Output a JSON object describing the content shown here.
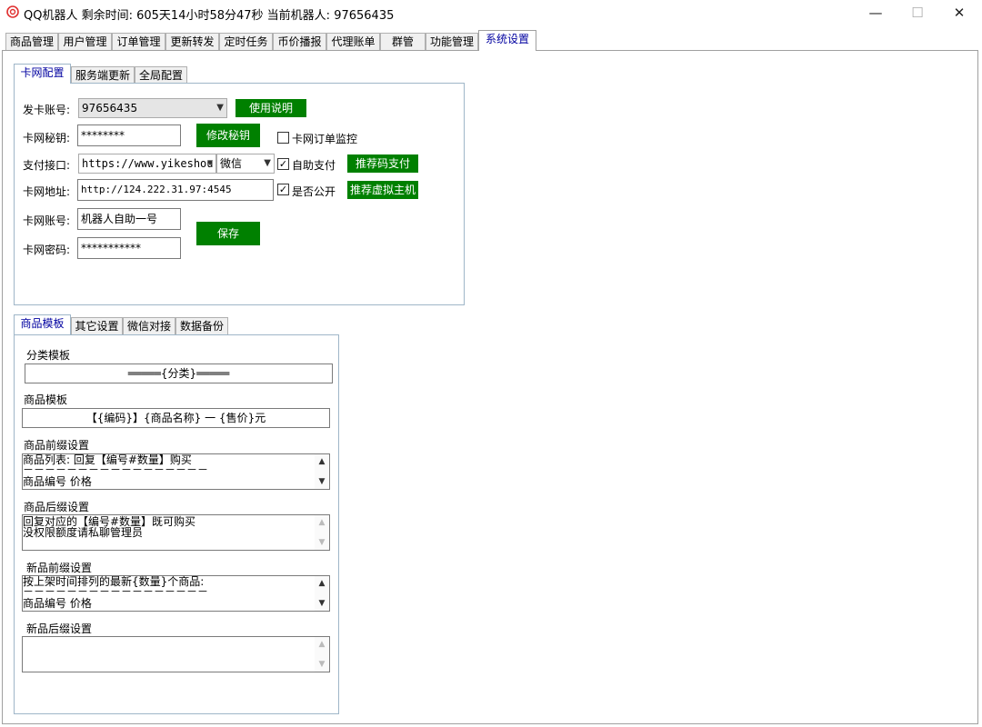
{
  "window": {
    "title": "QQ机器人 剩余时间: 605天14小时58分47秒 当前机器人: 97656435",
    "minimize": "—",
    "maximize": "☐",
    "close": "✕"
  },
  "main_tabs": [
    "商品管理",
    "用户管理",
    "订单管理",
    "更新转发",
    "定时任务",
    "币价播报",
    "代理账单",
    "群管",
    "功能管理",
    "系统设置"
  ],
  "top_subtabs": [
    "卡网配置",
    "服务端更新",
    "全局配置"
  ],
  "card_config": {
    "account_label": "发卡账号:",
    "account_value": "97656435",
    "usage_button": "使用说明",
    "secret_label": "卡网秘钥:",
    "secret_value": "********",
    "change_secret_button": "修改秘钥",
    "monitor_label": "卡网订单监控",
    "payment_label": "支付接口:",
    "payment_url": "https://www.yikeshou.",
    "payment_method": "微信",
    "auto_pay_label": "自助支付",
    "recommend_pay_button": "推荐码支付",
    "address_label": "卡网地址:",
    "address_value": "http://124.222.31.97:4545",
    "public_label": "是否公开",
    "recommend_host_button": "推荐虚拟主机",
    "card_account_label": "卡网账号:",
    "card_account_value": "机器人自助一号",
    "card_password_label": "卡网密码:",
    "card_password_value": "***********",
    "save_button": "保存"
  },
  "bottom_subtabs": [
    "商品模板",
    "其它设置",
    "微信对接",
    "数据备份"
  ],
  "templates": {
    "category_label": "分类模板",
    "category_value": "═════{分类}═════",
    "product_label": "商品模板",
    "product_value": "【{编码}】{商品名称} 一 {售价}元",
    "prefix_label": "商品前缀设置",
    "prefix_lines": [
      "商品列表: 回复【编号#数量】购买",
      "－－－－－－－－－－－－－－－－－",
      "商品编号                                            价格"
    ],
    "suffix_label": "商品后缀设置",
    "suffix_lines": [
      "回复对应的【编号#数量】既可购买",
      "没权限额度请私聊管理员"
    ],
    "new_prefix_label": "新品前缀设置",
    "new_prefix_lines": [
      "按上架时间排列的最新{数量}个商品:",
      "－－－－－－－－－－－－－－－－－",
      "商品编号                                            价格"
    ],
    "new_suffix_label": "新品后缀设置"
  }
}
